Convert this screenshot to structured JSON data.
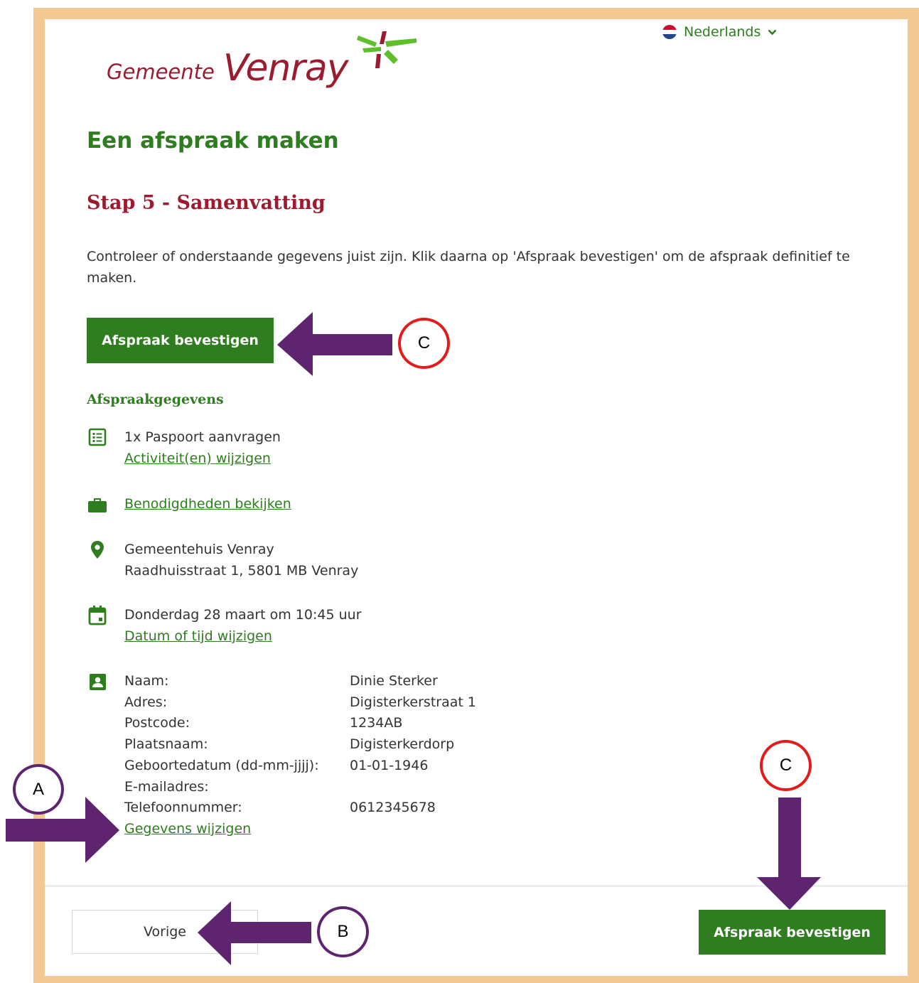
{
  "language": {
    "label": "Nederlands",
    "flag_colors": [
      "#c8102e",
      "#ffffff",
      "#21468b"
    ]
  },
  "logo": {
    "word1": "Gemeente",
    "word2": "Venray"
  },
  "page_title": "Een afspraak maken",
  "step_title": "Stap 5 - Samenvatting",
  "intro": "Controleer of onderstaande gegevens juist zijn. Klik daarna op 'Afspraak bevestigen' om de afspraak definitief te maken.",
  "confirm_label": "Afspraak bevestigen",
  "section_title": "Afspraakgegevens",
  "activity": {
    "text": "1x Paspoort aanvragen",
    "link": "Activiteit(en) wijzigen"
  },
  "requirements": {
    "link": "Benodigdheden bekijken"
  },
  "location": {
    "name": "Gemeentehuis Venray",
    "address": "Raadhuisstraat 1, 5801 MB Venray"
  },
  "datetime": {
    "text": "Donderdag 28 maart om 10:45 uur",
    "link": "Datum of tijd wijzigen"
  },
  "personal": {
    "fields": [
      {
        "label": "Naam:",
        "value": "Dinie Sterker"
      },
      {
        "label": "Adres:",
        "value": "Digisterkerstraat 1"
      },
      {
        "label": "Postcode:",
        "value": "1234AB"
      },
      {
        "label": "Plaatsnaam:",
        "value": "Digisterkerdorp"
      },
      {
        "label": "Geboortedatum (dd-mm-jjjj):",
        "value": "01-01-1946"
      },
      {
        "label": "E-mailadres:",
        "value": ""
      },
      {
        "label": "Telefoonnummer:",
        "value": "0612345678"
      }
    ],
    "link": "Gegevens wijzigen"
  },
  "footer": {
    "back_label": "Vorige",
    "confirm_label": "Afspraak bevestigen"
  },
  "annotations": {
    "a": "A",
    "b": "B",
    "c": "C"
  },
  "colors": {
    "brand_green": "#2e7d1e",
    "brand_red": "#9b1b30",
    "frame": "#f2c992",
    "arrow_purple": "#5e2470",
    "marker_red": "#e31b1b"
  }
}
